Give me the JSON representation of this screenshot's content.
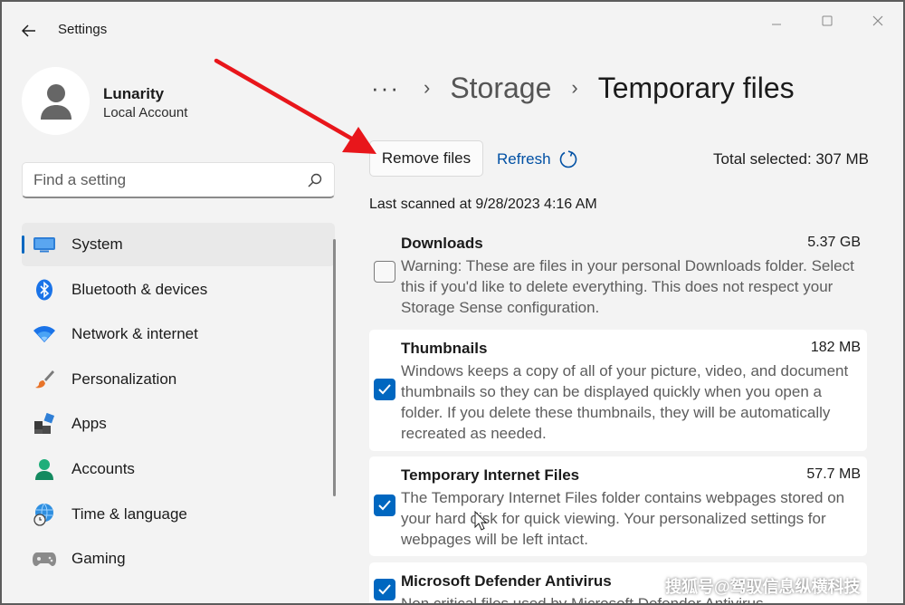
{
  "window": {
    "title": "Settings"
  },
  "profile": {
    "name": "Lunarity",
    "account_type": "Local Account"
  },
  "search": {
    "placeholder": "Find a setting"
  },
  "sidebar": {
    "items": [
      {
        "label": "System",
        "icon": "monitor-icon",
        "active": true
      },
      {
        "label": "Bluetooth & devices",
        "icon": "bluetooth-icon"
      },
      {
        "label": "Network & internet",
        "icon": "wifi-icon"
      },
      {
        "label": "Personalization",
        "icon": "brush-icon"
      },
      {
        "label": "Apps",
        "icon": "apps-icon"
      },
      {
        "label": "Accounts",
        "icon": "person-icon"
      },
      {
        "label": "Time & language",
        "icon": "globe-clock-icon"
      },
      {
        "label": "Gaming",
        "icon": "gamepad-icon"
      }
    ]
  },
  "breadcrumb": {
    "more": "···",
    "parent": "Storage",
    "current": "Temporary files"
  },
  "toolbar": {
    "remove_label": "Remove files",
    "refresh_label": "Refresh",
    "total_selected": "Total selected: 307 MB"
  },
  "last_scanned": "Last scanned at 9/28/2023 4:16 AM",
  "files": [
    {
      "title": "Downloads",
      "size": "5.37 GB",
      "checked": false,
      "description": "Warning: These are files in your personal Downloads folder. Select this if you'd like to delete everything. This does not respect your Storage Sense configuration."
    },
    {
      "title": "Thumbnails",
      "size": "182 MB",
      "checked": true,
      "description": "Windows keeps a copy of all of your picture, video, and document thumbnails so they can be displayed quickly when you open a folder. If you delete these thumbnails, they will be automatically recreated as needed."
    },
    {
      "title": "Temporary Internet Files",
      "size": "57.7 MB",
      "checked": true,
      "description": "The Temporary Internet Files folder contains webpages stored on your hard disk for quick viewing. Your personalized settings for webpages will be left intact."
    },
    {
      "title": "Microsoft Defender Antivirus",
      "size": "",
      "checked": true,
      "description": "Non critical files used by Microsoft Defender Antivirus"
    }
  ],
  "watermark": "搜狐号@驾驭信息纵横科技",
  "colors": {
    "accent": "#0067c0",
    "annotation_arrow": "#e8161b"
  }
}
